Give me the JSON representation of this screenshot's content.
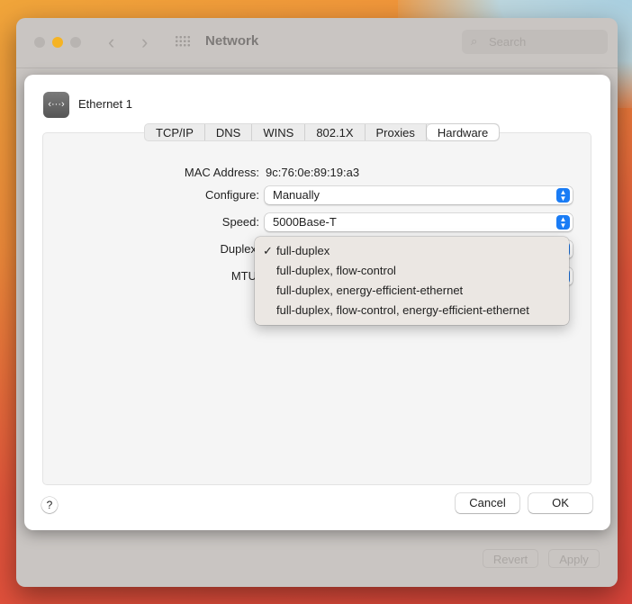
{
  "window": {
    "title": "Network",
    "search_placeholder": "Search",
    "revert_label": "Revert",
    "apply_label": "Apply"
  },
  "sheet": {
    "interface_name": "Ethernet 1",
    "tabs": [
      "TCP/IP",
      "DNS",
      "WINS",
      "802.1X",
      "Proxies",
      "Hardware"
    ],
    "selected_tab": "Hardware",
    "mac_label": "MAC Address:",
    "mac_value": "9c:76:0e:89:19:a3",
    "configure_label": "Configure:",
    "configure_value": "Manually",
    "speed_label": "Speed:",
    "speed_value": "5000Base-T",
    "duplex_label": "Duplex",
    "mtu_label": "MTU",
    "duplex_menu": {
      "options": [
        "full-duplex",
        "full-duplex, flow-control",
        "full-duplex, energy-efficient-ethernet",
        "full-duplex, flow-control, energy-efficient-ethernet"
      ],
      "checkmark": "✓",
      "selected": "full-duplex"
    },
    "help_label": "?",
    "cancel_label": "Cancel",
    "ok_label": "OK"
  },
  "colors": {
    "accent": "#1a7cf5",
    "minimize": "#f5b324"
  }
}
